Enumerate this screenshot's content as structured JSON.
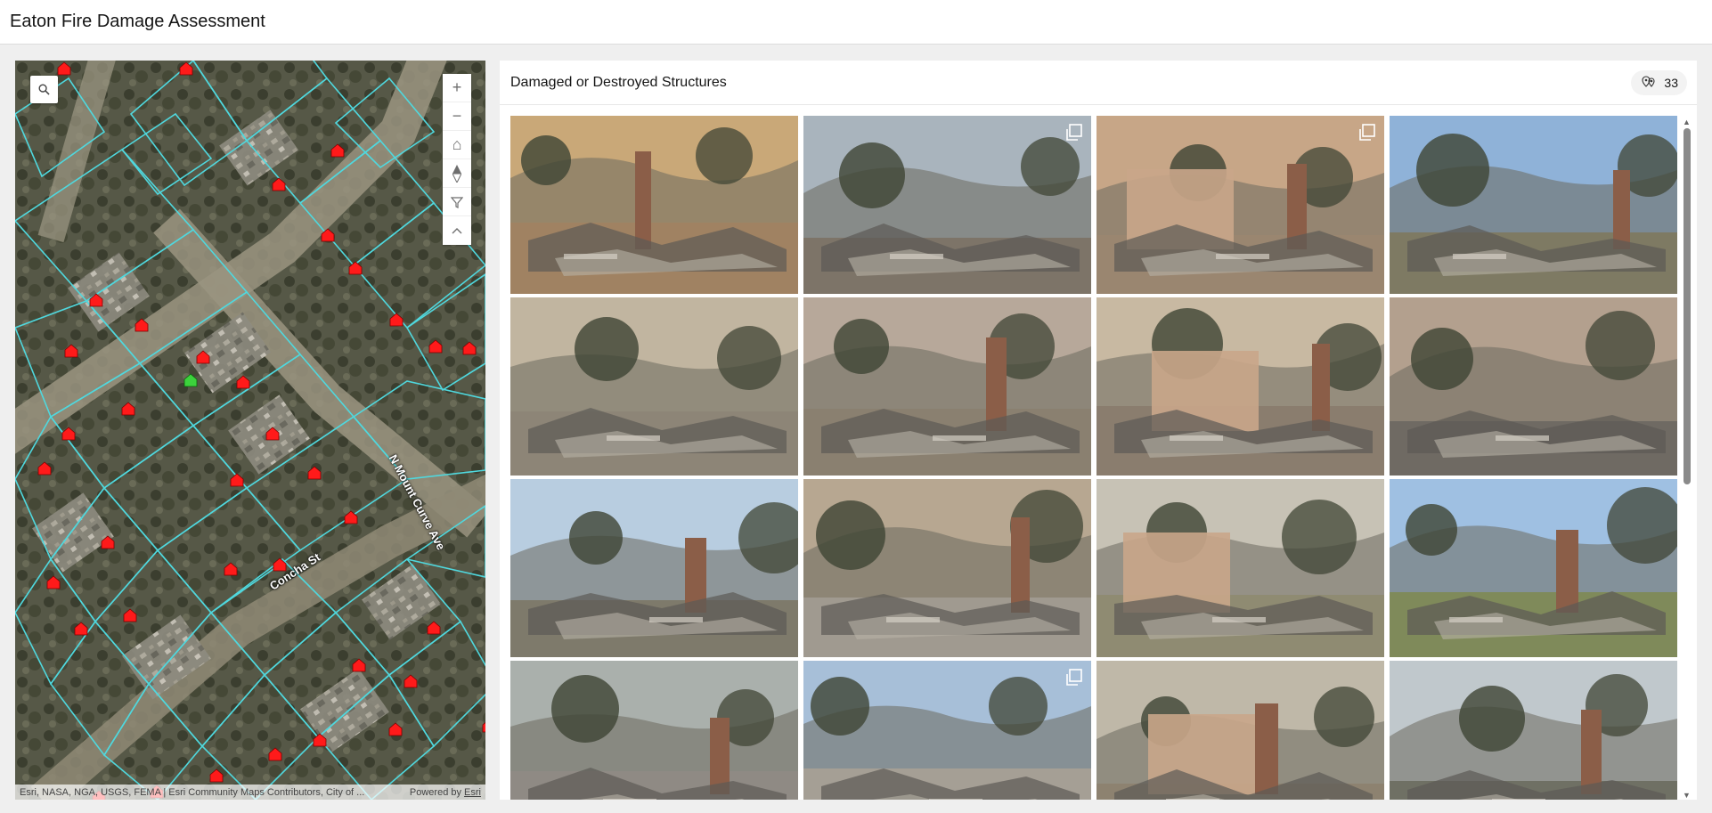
{
  "header": {
    "title": "Eaton Fire Damage Assessment"
  },
  "map": {
    "search_icon": "search-icon",
    "controls": [
      {
        "name": "zoom-in-button",
        "glyph": "+"
      },
      {
        "name": "zoom-out-button",
        "glyph": "−"
      },
      {
        "name": "home-button",
        "glyph": "⌂"
      },
      {
        "name": "compass-button",
        "glyph": "◆"
      },
      {
        "name": "filter-button",
        "glyph": "⊽"
      },
      {
        "name": "collapse-button",
        "glyph": "⌃"
      }
    ],
    "street_labels": {
      "mount_curve": "N Mount Curve Ave",
      "concha": "Concha St"
    },
    "attribution": "Esri, NASA, NGA, USGS, FEMA | Esri Community Maps Contributors, City of ...",
    "powered_by": "Powered by ",
    "powered_link": "Esri",
    "colors": {
      "parcel_line": "#4fd8de",
      "structure_marker": "#ff1a1a",
      "selected_marker": "#3cd23c"
    }
  },
  "gallery": {
    "title": "Damaged or Destroyed Structures",
    "count": "33",
    "count_icon": "cluster-icon",
    "multi_photo_icon": "stack-icon",
    "photos": [
      {
        "caption": "",
        "multi": false
      },
      {
        "caption": "",
        "multi": true
      },
      {
        "caption": "",
        "multi": true
      },
      {
        "caption": "",
        "multi": false
      },
      {
        "caption": "",
        "multi": false
      },
      {
        "caption": "",
        "multi": false
      },
      {
        "caption": "",
        "multi": false
      },
      {
        "caption": "",
        "multi": false
      },
      {
        "caption": "",
        "multi": false
      },
      {
        "caption": "",
        "multi": false
      },
      {
        "caption": "",
        "multi": false
      },
      {
        "caption": "",
        "multi": false
      },
      {
        "caption": "",
        "multi": false
      },
      {
        "caption": "",
        "multi": true
      },
      {
        "caption": "",
        "multi": false
      },
      {
        "caption": "",
        "multi": false
      }
    ]
  }
}
